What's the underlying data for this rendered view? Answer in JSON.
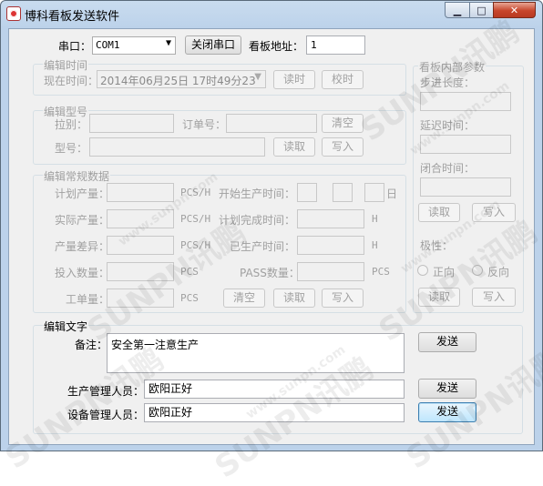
{
  "window": {
    "title": "博科看板发送软件",
    "minimize": "▁",
    "maximize": "□",
    "close": "✕"
  },
  "serial": {
    "port_label": "串口：",
    "port_value": "COM1",
    "close_port_button": "关闭串口",
    "address_label": "看板地址：",
    "address_value": "1"
  },
  "edit_time": {
    "group_title": "编辑时间",
    "now_label": "现在时间：",
    "datetime_value": "2014年06月25日 17时49分23",
    "read_button": "读时",
    "calibrate_button": "校时"
  },
  "edit_model": {
    "group_title": "编辑型号",
    "pull_label": "拉别：",
    "order_label": "订单号：",
    "clear_button": "清空",
    "model_label": "型号：",
    "read_button": "读取",
    "write_button": "写入"
  },
  "edit_data": {
    "group_title": "编辑常规数据",
    "plan_output_label": "计划产量：",
    "actual_output_label": "实际产量：",
    "output_diff_label": "产量差异：",
    "input_qty_label": "投入数量：",
    "work_order_label": "工单量：",
    "unit_pcs_h": "PCS/H",
    "unit_pcs": "PCS",
    "start_time_label": "开始生产时间：",
    "day_label": "日",
    "plan_finish_label": "计划完成时间：",
    "produced_time_label": "已生产时间：",
    "unit_h": "H",
    "pass_qty_label": "PASS数量：",
    "clear_button": "清空",
    "read_button": "读取",
    "write_button": "写入"
  },
  "board_params": {
    "group_title": "看板内部参数",
    "step_length_label": "步进长度：",
    "delay_label": "延迟时间：",
    "close_time_label": "闭合时间：",
    "read_button": "读取",
    "write_button": "写入",
    "polarity_label": "极性：",
    "forward_label": "正向",
    "reverse_label": "反向",
    "read_button2": "读取",
    "write_button2": "写入"
  },
  "edit_text": {
    "group_title": "编辑文字",
    "note_label": "备注：",
    "note_value": "安全第一注意生产",
    "send_button": "发送",
    "prod_manager_label": "生产管理人员：",
    "prod_manager_value": "欧阳正好",
    "prod_send_button": "发送",
    "equip_manager_label": "设备管理人员：",
    "equip_manager_value": "欧阳正好",
    "equip_send_button": "发送"
  },
  "watermarks": [
    "SUNPN讯鹏",
    "www.sunpn.com"
  ]
}
